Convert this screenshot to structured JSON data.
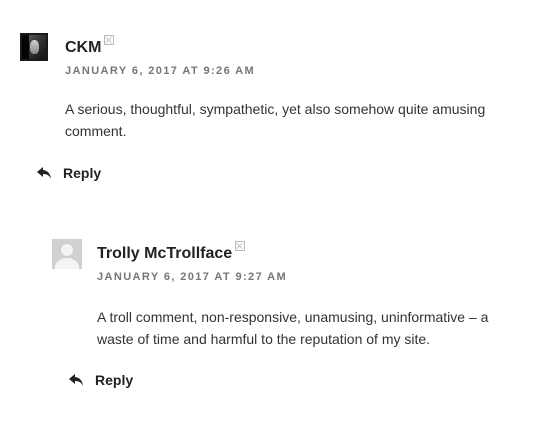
{
  "comments": [
    {
      "author": "CKM",
      "date": "JANUARY 6, 2017 AT 9:26 AM",
      "text": "A serious, thoughtful, sympathetic, yet also somehow quite amusing comment.",
      "reply_label": "Reply",
      "avatar": "photo"
    },
    {
      "author": "Trolly McTrollface",
      "date": "JANUARY 6, 2017 AT 9:27 AM",
      "text": "A troll comment, non-responsive, unamusing, uninformative – a waste of time and harmful to the reputation of my site.",
      "reply_label": "Reply",
      "avatar": "default"
    }
  ],
  "icons": {
    "reply": "reply-arrow-icon",
    "broken_image": "broken-image-icon",
    "default_avatar": "default-avatar-icon"
  }
}
